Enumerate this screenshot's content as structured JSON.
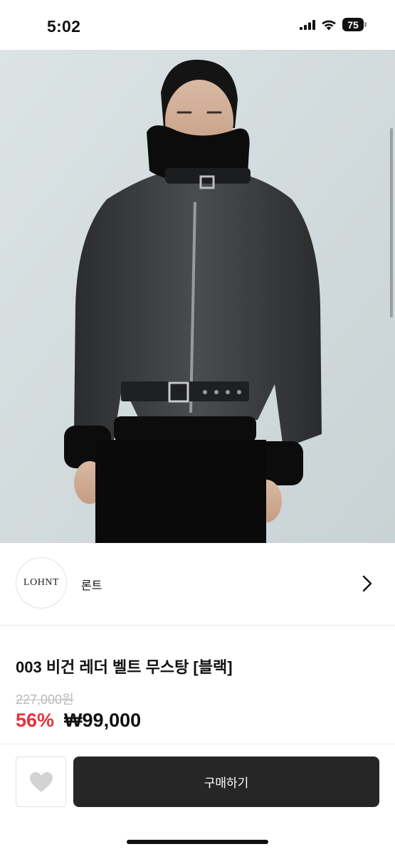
{
  "status_bar": {
    "time": "5:02",
    "battery": "75",
    "icons": [
      "signal-icon",
      "wifi-icon",
      "battery-icon"
    ]
  },
  "hero": {
    "image": "product-photo",
    "description_icon": "model-leather-jacket-image"
  },
  "seller": {
    "logo_text": "LOHNT",
    "name": "론트",
    "icon": "chevron-right-icon"
  },
  "product": {
    "title": "003 비건 레더 벨트 무스탕 [블랙]",
    "original_price": "227,000원",
    "discount_rate": "56%",
    "sale_price": "₩99,000"
  },
  "actions": {
    "like_icon": "heart-icon",
    "buy_label": "구매하기"
  },
  "colors": {
    "discount": "#e8313c",
    "buy_button": "#262626",
    "original_price": "#b9b9b9"
  }
}
